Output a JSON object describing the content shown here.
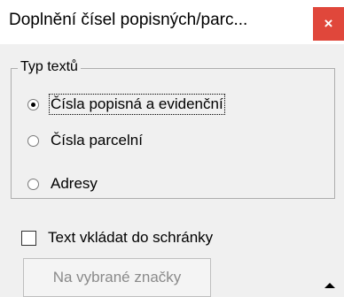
{
  "window": {
    "title": "Doplnění čísel popisných/parc...",
    "close_glyph": "×"
  },
  "text_type_group": {
    "legend": "Typ textů",
    "options": [
      {
        "label": "Čísla popisná a evidenční",
        "selected": true
      },
      {
        "label": "Čísla parcelní",
        "selected": false
      },
      {
        "label": "Adresy",
        "selected": false
      }
    ]
  },
  "clipboard_checkbox": {
    "label": "Text vkládat do schránky",
    "checked": false
  },
  "apply_button": {
    "label": "Na vybrané značky",
    "enabled": false
  },
  "colors": {
    "close_button": "#e0473b",
    "titlebar": "#ffffff",
    "dialog_bg": "#f0f0f0",
    "disabled_text": "#8a8a8a"
  },
  "icons": {
    "close": "close-icon",
    "expand": "arrow-up-icon"
  }
}
